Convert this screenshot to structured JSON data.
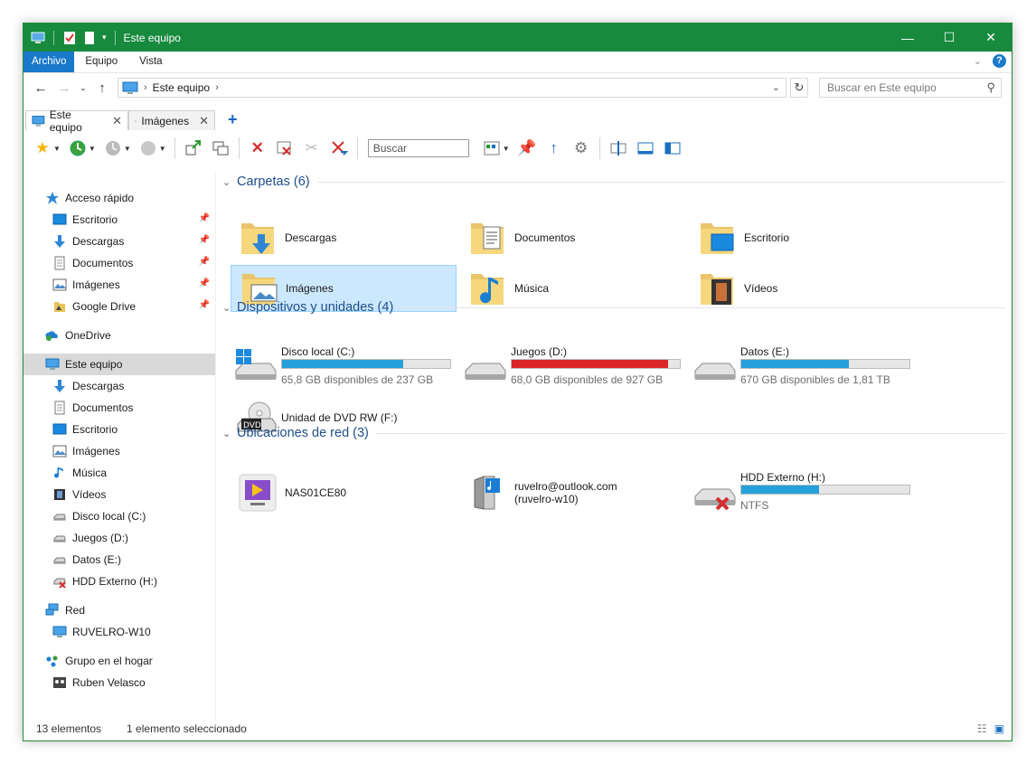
{
  "window": {
    "title": "Este equipo"
  },
  "ribbon": {
    "tabs": [
      "Archivo",
      "Equipo",
      "Vista"
    ]
  },
  "address": {
    "crumb": "Este equipo",
    "search_placeholder": "Buscar en Este equipo"
  },
  "tabs": [
    {
      "label": "Este equipo"
    },
    {
      "label": "Imágenes"
    }
  ],
  "toolbar": {
    "search_label": "Buscar"
  },
  "sidebar": {
    "items": [
      {
        "label": "Acceso rápido",
        "icon": "star-icon"
      },
      {
        "label": "Escritorio",
        "icon": "desktop-icon",
        "pinned": true
      },
      {
        "label": "Descargas",
        "icon": "download-icon",
        "pinned": true
      },
      {
        "label": "Documentos",
        "icon": "document-icon",
        "pinned": true
      },
      {
        "label": "Imágenes",
        "icon": "pictures-icon",
        "pinned": true
      },
      {
        "label": "Google Drive",
        "icon": "google-drive-icon",
        "pinned": true
      },
      {
        "label": "OneDrive",
        "icon": "onedrive-icon"
      },
      {
        "label": "Este equipo",
        "icon": "computer-icon",
        "selected": true
      },
      {
        "label": "Descargas",
        "icon": "download-icon"
      },
      {
        "label": "Documentos",
        "icon": "document-icon"
      },
      {
        "label": "Escritorio",
        "icon": "desktop-icon"
      },
      {
        "label": "Imágenes",
        "icon": "pictures-icon"
      },
      {
        "label": "Música",
        "icon": "music-icon"
      },
      {
        "label": "Vídeos",
        "icon": "videos-icon"
      },
      {
        "label": "Disco local (C:)",
        "icon": "drive-icon"
      },
      {
        "label": "Juegos (D:)",
        "icon": "drive-icon"
      },
      {
        "label": "Datos (E:)",
        "icon": "drive-icon"
      },
      {
        "label": "HDD Externo (H:)",
        "icon": "disconnected-drive-icon"
      },
      {
        "label": "Red",
        "icon": "network-icon"
      },
      {
        "label": "RUVELRO-W10",
        "icon": "computer-icon"
      },
      {
        "label": "Grupo en el hogar",
        "icon": "homegroup-icon"
      },
      {
        "label": "Ruben Velasco",
        "icon": "user-icon"
      }
    ]
  },
  "groups": {
    "folders": {
      "title": "Carpetas (6)"
    },
    "drives": {
      "title": "Dispositivos y unidades (4)"
    },
    "network": {
      "title": "Ubicaciones de red (3)"
    }
  },
  "folders": [
    {
      "label": "Descargas",
      "icon": "downloads-folder-icon"
    },
    {
      "label": "Documentos",
      "icon": "documents-folder-icon"
    },
    {
      "label": "Escritorio",
      "icon": "desktop-folder-icon"
    },
    {
      "label": "Imágenes",
      "icon": "pictures-folder-icon",
      "selected": true
    },
    {
      "label": "Música",
      "icon": "music-folder-icon"
    },
    {
      "label": "Vídeos",
      "icon": "videos-folder-icon"
    }
  ],
  "drives": [
    {
      "name": "Disco local (C:)",
      "free": "65,8 GB disponibles de 237 GB",
      "used_fraction": 0.72
    },
    {
      "name": "Juegos (D:)",
      "free": "68,0 GB disponibles de 927 GB",
      "used_fraction": 0.93
    },
    {
      "name": "Datos (E:)",
      "free": "670 GB disponibles de 1,81 TB",
      "used_fraction": 0.64
    },
    {
      "name": "Unidad de DVD RW (F:)"
    }
  ],
  "network": [
    {
      "label": "NAS01CE80"
    },
    {
      "label": "ruvelro@outlook.com",
      "sub": "(ruvelro-w10)"
    },
    {
      "name": "HDD Externo (H:)",
      "free": "NTFS",
      "used_fraction": 0.46
    }
  ],
  "status": {
    "count": "13 elementos",
    "selection": "1 elemento seleccionado"
  },
  "colors": {
    "titlebar": "#178a3e",
    "accent": "#1979ca",
    "bar_blue": "#26a0da",
    "bar_red": "#da2626",
    "selection": "#cce8ff"
  }
}
